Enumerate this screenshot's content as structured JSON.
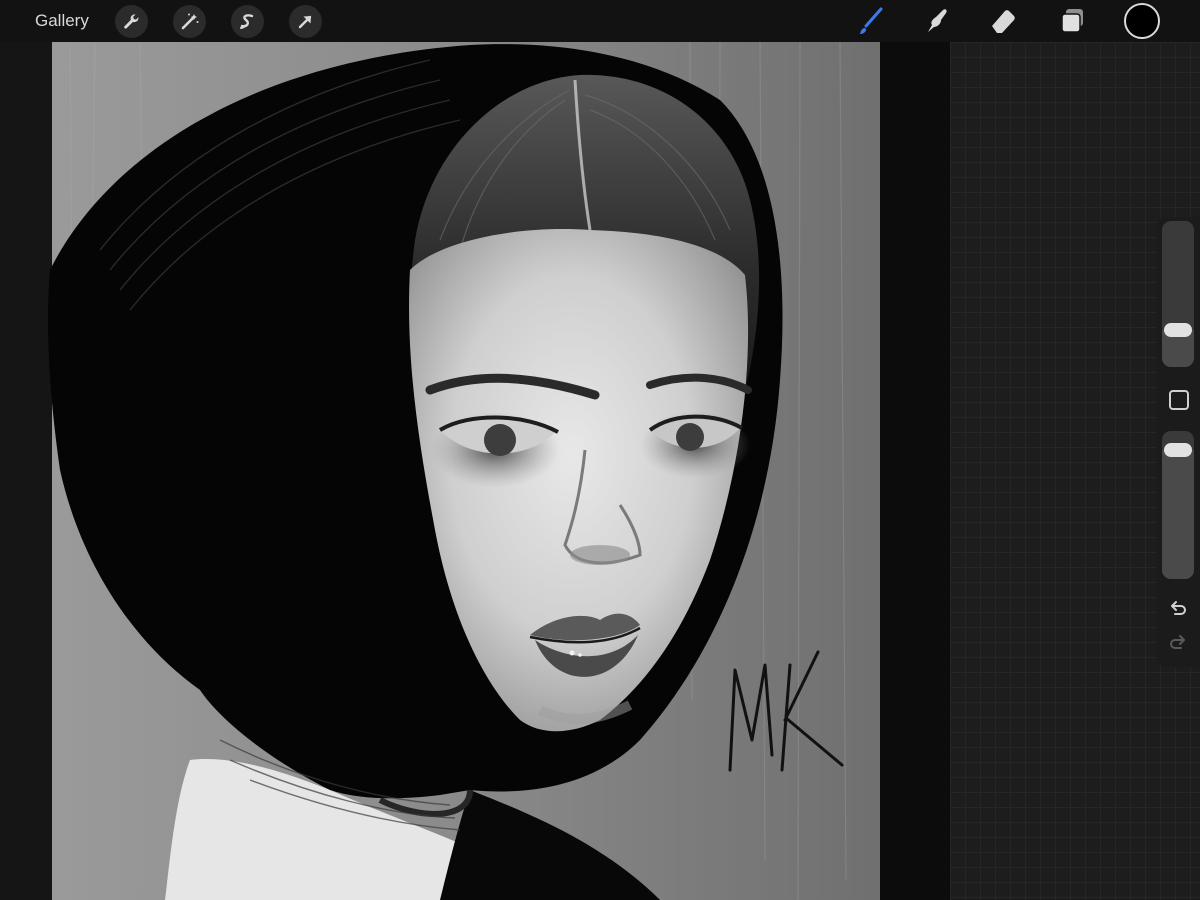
{
  "toolbar": {
    "gallery_label": "Gallery",
    "left_tools": [
      {
        "name": "actions-icon"
      },
      {
        "name": "adjustments-icon"
      },
      {
        "name": "selection-icon"
      },
      {
        "name": "transform-icon"
      }
    ],
    "right_tools": [
      {
        "name": "brush-icon",
        "active": true
      },
      {
        "name": "smudge-icon",
        "active": false
      },
      {
        "name": "eraser-icon",
        "active": false
      },
      {
        "name": "layers-icon",
        "active": false
      }
    ],
    "current_color": "#000000",
    "accent_color": "#3a7bf0"
  },
  "sidebar": {
    "brush_size_level": 0.2,
    "opacity_level": 0.95,
    "controls": [
      "modify-button",
      "undo-icon",
      "redo-icon"
    ]
  },
  "canvas": {
    "signature_text": "MK"
  }
}
